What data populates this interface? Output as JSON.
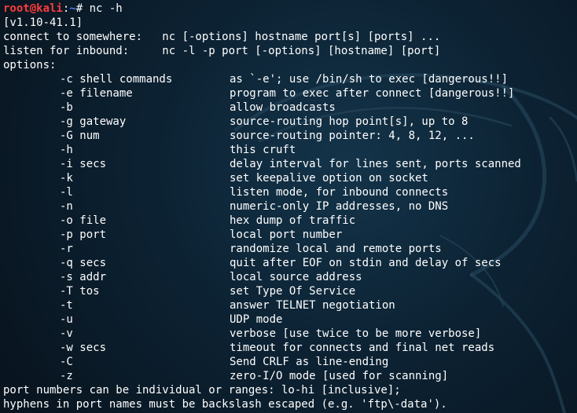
{
  "prompt": {
    "user_host": "root@kali",
    "sep": ":",
    "path": "~",
    "symbol": "# ",
    "command": "nc -h"
  },
  "version": "[v1.10-41.1]",
  "usage": [
    "connect to somewhere:   nc [-options] hostname port[s] [ports] ...",
    "listen for inbound:     nc -l -p port [-options] [hostname] [port]"
  ],
  "options_header": "options:",
  "options": [
    {
      "flag": "-c shell commands",
      "desc": "as `-e'; use /bin/sh to exec [dangerous!!]"
    },
    {
      "flag": "-e filename",
      "desc": "program to exec after connect [dangerous!!]"
    },
    {
      "flag": "-b",
      "desc": "allow broadcasts"
    },
    {
      "flag": "-g gateway",
      "desc": "source-routing hop point[s], up to 8"
    },
    {
      "flag": "-G num",
      "desc": "source-routing pointer: 4, 8, 12, ..."
    },
    {
      "flag": "-h",
      "desc": "this cruft"
    },
    {
      "flag": "-i secs",
      "desc": "delay interval for lines sent, ports scanned"
    },
    {
      "flag": "-k",
      "desc": "set keepalive option on socket"
    },
    {
      "flag": "-l",
      "desc": "listen mode, for inbound connects"
    },
    {
      "flag": "-n",
      "desc": "numeric-only IP addresses, no DNS"
    },
    {
      "flag": "-o file",
      "desc": "hex dump of traffic"
    },
    {
      "flag": "-p port",
      "desc": "local port number"
    },
    {
      "flag": "-r",
      "desc": "randomize local and remote ports"
    },
    {
      "flag": "-q secs",
      "desc": "quit after EOF on stdin and delay of secs"
    },
    {
      "flag": "-s addr",
      "desc": "local source address"
    },
    {
      "flag": "-T tos",
      "desc": "set Type Of Service"
    },
    {
      "flag": "-t",
      "desc": "answer TELNET negotiation"
    },
    {
      "flag": "-u",
      "desc": "UDP mode"
    },
    {
      "flag": "-v",
      "desc": "verbose [use twice to be more verbose]"
    },
    {
      "flag": "-w secs",
      "desc": "timeout for connects and final net reads"
    },
    {
      "flag": "-C",
      "desc": "Send CRLF as line-ending"
    },
    {
      "flag": "-z",
      "desc": "zero-I/O mode [used for scanning]"
    }
  ],
  "footer": [
    "port numbers can be individual or ranges: lo-hi [inclusive];",
    "hyphens in port names must be backslash escaped (e.g. 'ftp\\-data')."
  ],
  "colors": {
    "background": "#0c2233",
    "text": "#ffffff",
    "prompt_user": "#ff3b3b",
    "prompt_path": "#4f7dff"
  },
  "icons": [
    "kali-dragon-watermark"
  ]
}
